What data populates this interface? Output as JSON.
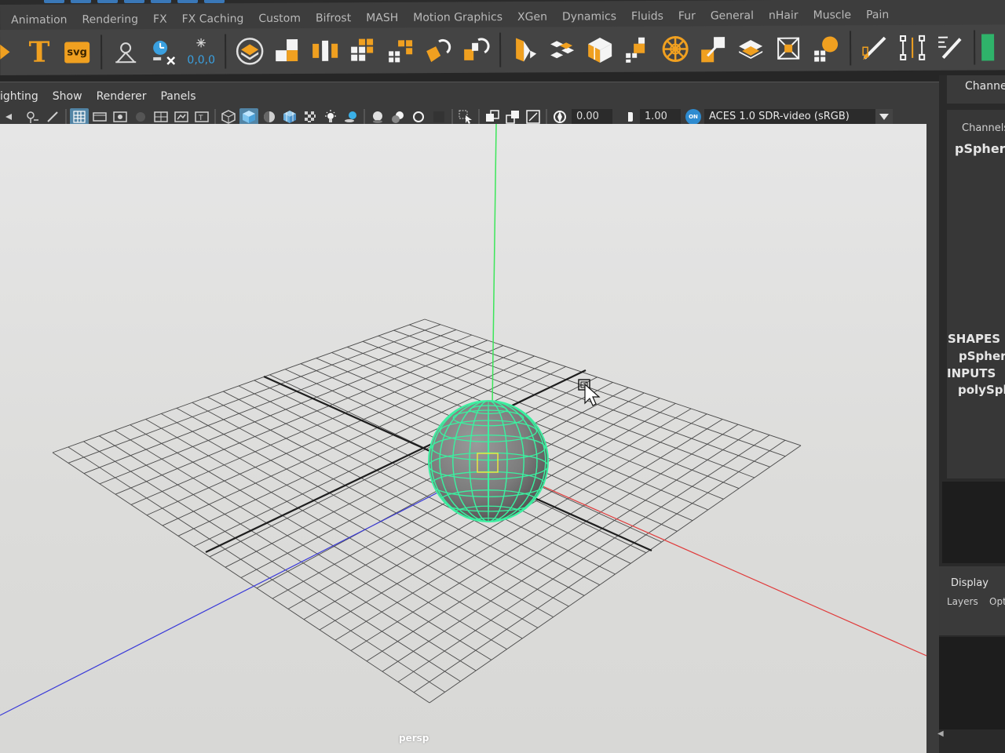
{
  "shelf_tabs": [
    "Animation",
    "Rendering",
    "FX",
    "FX Caching",
    "Custom",
    "Bifrost",
    "MASH",
    "Motion Graphics",
    "XGen",
    "Dynamics",
    "Fluids",
    "Fur",
    "General",
    "nHair",
    "Muscle",
    "Pain"
  ],
  "shelf": {
    "text_icon_glyph": "T",
    "svg_icon_label": "svg",
    "origin_label": "0,0,0"
  },
  "panel_menu": [
    "ighting",
    "Show",
    "Renderer",
    "Panels"
  ],
  "panel_toolbar": {
    "exposure": "0.00",
    "gamma": "1.00",
    "cm_badge": "ON",
    "view_transform": "ACES 1.0 SDR-video (sRGB)"
  },
  "viewport": {
    "camera": "persp"
  },
  "channel_box": {
    "title": "Channel",
    "channels_menu": "Channels",
    "object": "pSphere",
    "shapes_label": "SHAPES",
    "shape": "pSpher",
    "inputs_label": "INPUTS",
    "input": "polySph"
  },
  "layer_editor": {
    "display_tab": "Display",
    "layers_menu": "Layers",
    "options_menu": "Opt"
  },
  "colors": {
    "selection_green": "#3bf0a0",
    "grid_line": "#4a4a4a",
    "x_axis": "#e03a3a",
    "y_axis": "#3ce65a",
    "z_axis": "#3a3ad8",
    "active_blue": "#5285a6",
    "accent_orange": "#f0a020"
  },
  "icons": [
    "move-tool-icon",
    "text-icon",
    "svg-icon",
    "locator-icon",
    "clock-icon",
    "origin-icon",
    "render-setup-icon",
    "mash-icon",
    "camera-icon",
    "selection-icon",
    "wireframe-icon",
    "shaded-icon",
    "light-icon",
    "exposure-icon",
    "gamma-icon"
  ]
}
